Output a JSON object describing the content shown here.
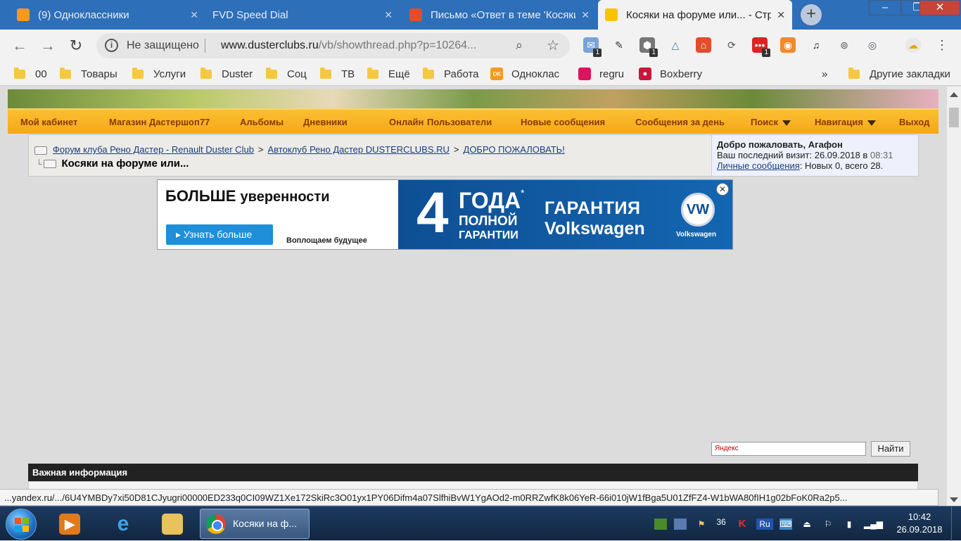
{
  "browser": {
    "tabs": [
      {
        "title": "(9) Одноклассники",
        "favicon_color": "#f59a1f",
        "favicon_glyph": "ok-icon"
      },
      {
        "title": "FVD Speed Dial",
        "favicon_color": "",
        "favicon_glyph": ""
      },
      {
        "title": "Письмо «Ответ в теме 'Косяки",
        "favicon_color": "#e44c2c",
        "favicon_glyph": "mail-icon"
      },
      {
        "title": "Косяки на форуме или... - Стр",
        "favicon_color": "#222",
        "favicon_glyph": "renault-icon"
      }
    ],
    "window_controls": [
      "–",
      "❐",
      "✕"
    ],
    "omnibox": {
      "security": "Не защищено",
      "url_host": "www.dusterclubs.ru",
      "url_path": "/vb/showthread.php?p=10264..."
    },
    "extension_badges": [
      "1",
      "1",
      "1"
    ],
    "bookmarks": [
      {
        "label": "00",
        "type": "folder"
      },
      {
        "label": "Товары",
        "type": "folder"
      },
      {
        "label": "Услуги",
        "type": "folder"
      },
      {
        "label": "Duster",
        "type": "folder"
      },
      {
        "label": "Соц",
        "type": "folder"
      },
      {
        "label": "ТВ",
        "type": "folder"
      },
      {
        "label": "Ещё",
        "type": "folder"
      },
      {
        "label": "Работа",
        "type": "folder"
      },
      {
        "label": "Одноклас",
        "type": "site",
        "color": "#f59a1f"
      },
      {
        "label": "regru",
        "type": "site",
        "color": "#e0115f"
      },
      {
        "label": "Boxberry",
        "type": "site",
        "color": "#c8173d"
      }
    ],
    "bookmarks_overflow": "»",
    "other_bookmarks": "Другие закладки"
  },
  "page": {
    "nav": [
      "Мой кабинет",
      "Магазин Дастершоп77",
      "Альбомы",
      "Дневники",
      "Онлайн",
      "Пользователи",
      "Новые сообщения",
      "Сообщения за день",
      "Поиск",
      "Навигация",
      "Выход"
    ],
    "breadcrumbs": [
      "Форум клуба Рено Дастер - Renault Duster Club",
      "Автоклуб Рено Дастер DUSTERCLUBS.RU",
      "ДОБРО ПОЖАЛОВАТЬ!"
    ],
    "breadcrumb_separator": ">",
    "thread_title": "Косяки на форуме или...",
    "welcome": {
      "greeting": "Добро пожаловать, Агафон",
      "last_visit_label": "Ваш последний визит: 26.09.2018 в",
      "last_visit_time": "08:31",
      "pm_link": "Личные сообщения",
      "pm_stats": ": Новых 0, всего 28."
    },
    "ad": {
      "headline_bold": "БОЛЬШЕ",
      "headline_rest": "уверенности",
      "button": "Узнать больше",
      "slogan": "Воплощаем будущее",
      "big_number": "4",
      "years": "ГОДА",
      "star": "*",
      "full": "ПОЛНОЙ",
      "warranty_small": "ГАРАНТИИ",
      "warranty": "ГАРАНТИЯ",
      "brand": "Volkswagen",
      "logo_text": "VW",
      "brand_small": "Volkswagen"
    },
    "yandex_search": {
      "placeholder": "Яндекс",
      "button": "Найти"
    },
    "info_header": "Важная информация",
    "status_url": "...yandex.ru/.../6U4YMBDy7xi50D81CJyugri00000ED233q0CI09WZ1Xe172SkiRc3O01yx1PY06Difm4a07SlfhiBvW1YgAOd2-m0RRZwfK8k06YeR-66i010jW1fBga5U01ZfFZ4-W1bWA80fIH1g02bFoK0Ra2p5..."
  },
  "taskbar": {
    "active_app": "Косяки на ф...",
    "tray_number": "36",
    "tray_lang": "Ru",
    "time": "10:42",
    "date": "26.09.2018"
  }
}
